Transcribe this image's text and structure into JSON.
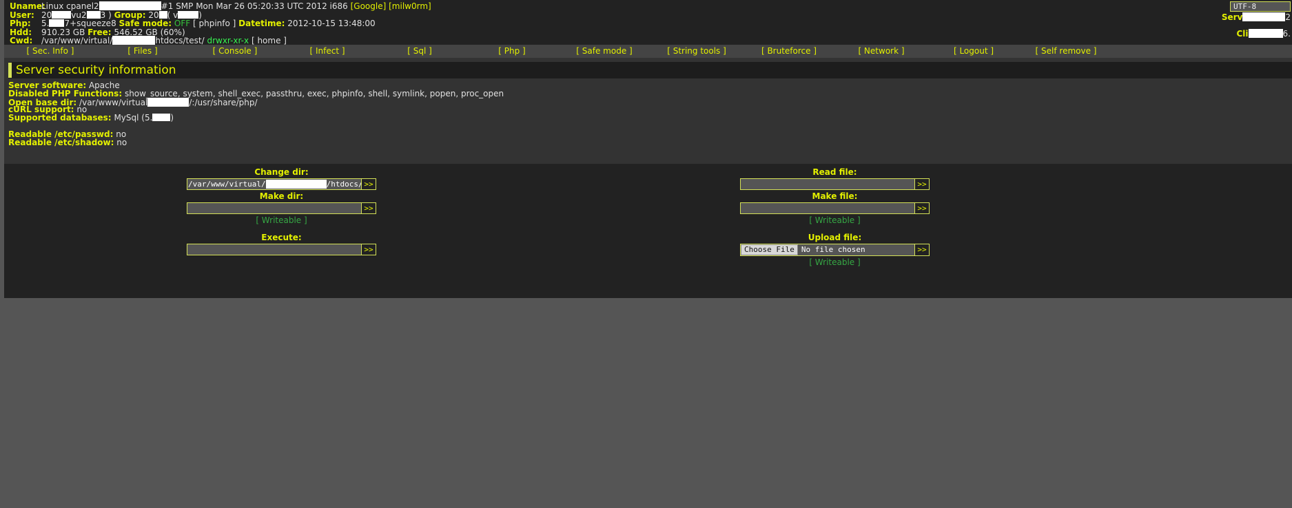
{
  "header": {
    "uname": {
      "label": "Uname:",
      "value_pre": "Linux cpanel2",
      "value_post": "#1 SMP Mon Mar 26 05:20:33 UTC 2012 i686",
      "google_link": "[Google]",
      "milworm_link": "[milw0rm]"
    },
    "user": {
      "label": "User:",
      "uid_pre": "20",
      "uid_mid": "vu2",
      "uid_post": "3 )",
      "group_label": "Group:",
      "gid_pre": "20",
      "gid_post": "( v",
      "gid_end": ")"
    },
    "php": {
      "label": "Php:",
      "version_pre": "5.",
      "version_post": "7+squeeze8",
      "safemode_label": "Safe mode:",
      "safemode_value": "OFF",
      "phpinfo_link": "[ phpinfo ]",
      "datetime_label": "Datetime:",
      "datetime_value": "2012-10-15 13:48:00"
    },
    "hdd": {
      "label": "Hdd:",
      "total": "910.23 GB",
      "free_label": "Free:",
      "free": "546.52 GB (60%)"
    },
    "cwd": {
      "label": "Cwd:",
      "path_pre": "/var/www/virtual/",
      "path_post": "htdocs/test/",
      "perms": "drwxr-xr-x",
      "home_link": "[ home ]"
    },
    "charset_value": "UTF-8",
    "server_time_label": "Serv",
    "server_time_value": "2",
    "client_time_label": "Cli",
    "client_time_value": "6."
  },
  "menu": {
    "items": [
      {
        "label": "[ Sec. Info ]",
        "name": "sec-info"
      },
      {
        "label": "[ Files ]",
        "name": "files"
      },
      {
        "label": "[ Console ]",
        "name": "console"
      },
      {
        "label": "[ Infect ]",
        "name": "infect"
      },
      {
        "label": "[ Sql ]",
        "name": "sql"
      },
      {
        "label": "[ Php ]",
        "name": "php"
      },
      {
        "label": "[ Safe mode ]",
        "name": "safe-mode"
      },
      {
        "label": "[ String tools ]",
        "name": "string-tools"
      },
      {
        "label": "[ Bruteforce ]",
        "name": "bruteforce"
      },
      {
        "label": "[ Network ]",
        "name": "network"
      },
      {
        "label": "[ Logout ]",
        "name": "logout"
      },
      {
        "label": "[ Self remove ]",
        "name": "self-remove"
      }
    ]
  },
  "section": {
    "title": "Server security information"
  },
  "security": {
    "server_software_label": "Server software:",
    "server_software_value": "Apache",
    "disabled_functions_label": "Disabled PHP Functions:",
    "disabled_functions_value": "show_source, system, shell_exec, passthru, exec, phpinfo, shell, symlink, popen, proc_open",
    "open_basedir_label": "Open base dir:",
    "open_basedir_pre": "/var/www/virtual",
    "open_basedir_post": "/:/usr/share/php/",
    "curl_label": "cURL support:",
    "curl_value": "no",
    "databases_label": "Supported databases:",
    "databases_pre": "MySql (5.",
    "databases_post": ")",
    "readable_passwd_label": "Readable /etc/passwd:",
    "readable_passwd_value": "no",
    "readable_shadow_label": "Readable /etc/shadow:",
    "readable_shadow_value": "no"
  },
  "forms": {
    "change_dir": {
      "label": "Change dir:",
      "value_pre": "/var/www/virtual/",
      "value_post": "/htdocs/test/",
      "submit": ">>"
    },
    "make_dir": {
      "label": "Make dir:",
      "value": "",
      "submit": ">>",
      "status": "[ Writeable ]"
    },
    "execute": {
      "label": "Execute:",
      "value": "",
      "submit": ">>"
    },
    "read_file": {
      "label": "Read file:",
      "value": "",
      "submit": ">>"
    },
    "make_file": {
      "label": "Make file:",
      "value": "",
      "submit": ">>",
      "status": "[ Writeable ]"
    },
    "upload_file": {
      "label": "Upload file:",
      "choose_button": "Choose File",
      "filename": "No file chosen",
      "submit": ">>",
      "status": "[ Writeable ]"
    }
  },
  "colors": {
    "accent": "#e3f000",
    "green": "#36c23c",
    "page_bg": "#222222",
    "panel_bg": "#333333",
    "menu_bg": "#444444"
  }
}
